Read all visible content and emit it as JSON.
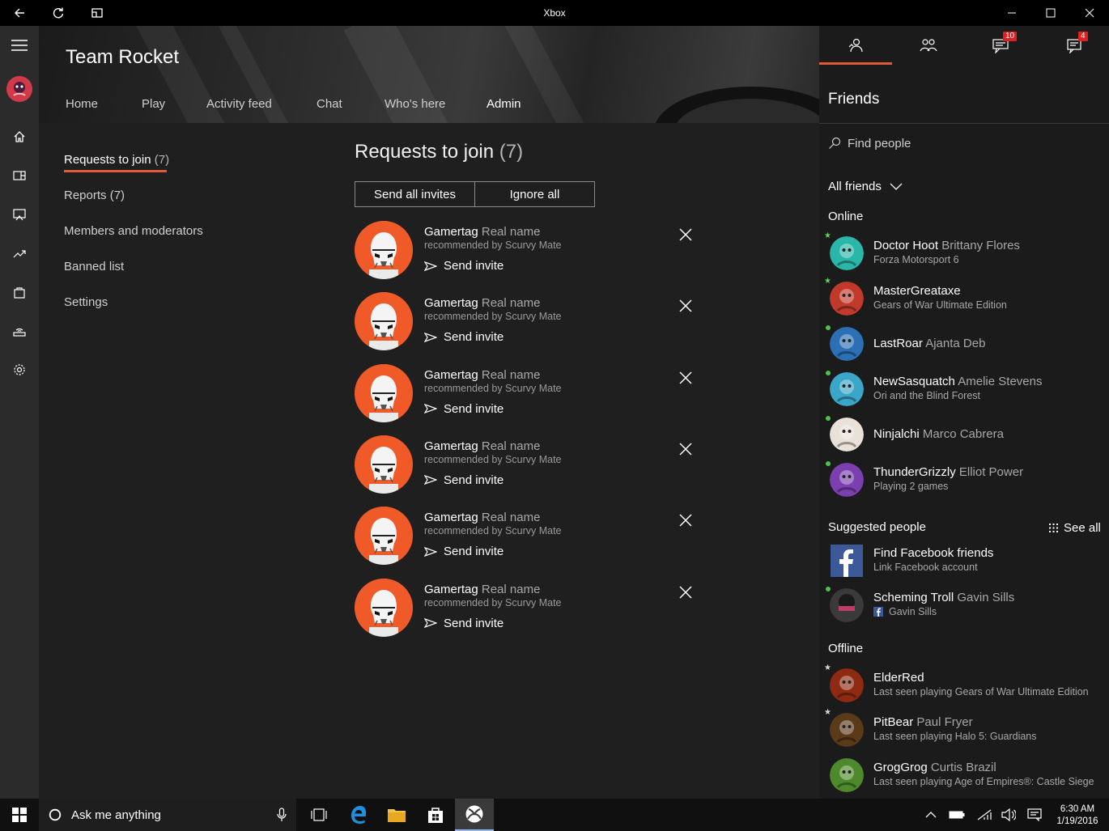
{
  "window": {
    "title": "Xbox"
  },
  "club": {
    "name": "Team Rocket"
  },
  "tabs": [
    "Home",
    "Play",
    "Activity feed",
    "Chat",
    "Who's here",
    "Admin"
  ],
  "admin_nav": {
    "items": [
      {
        "label": "Requests to join",
        "count": "(7)"
      },
      {
        "label": "Reports",
        "count": "(7)"
      },
      {
        "label": "Members and moderators",
        "count": ""
      },
      {
        "label": "Banned list",
        "count": ""
      },
      {
        "label": "Settings",
        "count": ""
      }
    ]
  },
  "requests": {
    "title": "Requests to join",
    "count": "(7)",
    "send_all": "Send all invites",
    "ignore_all": "Ignore all",
    "items": [
      {
        "gamertag": "Gamertag",
        "real_name": "Real name",
        "recommended": "recommended by Scurvy Mate",
        "action": "Send invite"
      },
      {
        "gamertag": "Gamertag",
        "real_name": "Real name",
        "recommended": "recommended by Scurvy Mate",
        "action": "Send invite"
      },
      {
        "gamertag": "Gamertag",
        "real_name": "Real name",
        "recommended": "recommended by Scurvy Mate",
        "action": "Send invite"
      },
      {
        "gamertag": "Gamertag",
        "real_name": "Real name",
        "recommended": "recommended by Scurvy Mate",
        "action": "Send invite"
      },
      {
        "gamertag": "Gamertag",
        "real_name": "Real name",
        "recommended": "recommended by Scurvy Mate",
        "action": "Send invite"
      },
      {
        "gamertag": "Gamertag",
        "real_name": "Real name",
        "recommended": "recommended by Scurvy Mate",
        "action": "Send invite"
      }
    ]
  },
  "friends_pane": {
    "title": "Friends",
    "badges": {
      "messages": "10",
      "notifications": "4"
    },
    "search_placeholder": "Find people",
    "filter": "All friends",
    "online_label": "Online",
    "online": [
      {
        "gamertag": "Doctor Hoot",
        "real_name": "Brittany Flores",
        "status": "Forza Motorsport 6",
        "favorite": true,
        "color": "#2ab7a9"
      },
      {
        "gamertag": "MasterGreataxe",
        "real_name": "",
        "status": "Gears of War Ultimate Edition",
        "favorite": true,
        "color": "#c0392b"
      },
      {
        "gamertag": "LastRoar",
        "real_name": "Ajanta Deb",
        "status": "",
        "favorite": false,
        "color": "#2c6fb5"
      },
      {
        "gamertag": "NewSasquatch",
        "real_name": "Amelie Stevens",
        "status": "Ori and the Blind Forest",
        "favorite": false,
        "color": "#3aa6c9"
      },
      {
        "gamertag": "Ninjalchi",
        "real_name": "Marco Cabrera",
        "status": "",
        "favorite": false,
        "color": "#e8e2d8"
      },
      {
        "gamertag": "ThunderGrizzly",
        "real_name": "Elliot Power",
        "status": "Playing 2 games",
        "favorite": false,
        "color": "#7b3fb0"
      }
    ],
    "suggested_label": "Suggested people",
    "see_all": "See all",
    "suggested": [
      {
        "gamertag": "Find Facebook friends",
        "real_name": "",
        "status": "Link Facebook account",
        "color": "#3b5998"
      },
      {
        "gamertag": "Scheming Troll",
        "real_name": "Gavin Sills",
        "status": "Gavin Sills",
        "color": "#444444"
      }
    ],
    "offline_label": "Offline",
    "offline": [
      {
        "gamertag": "ElderRed",
        "real_name": "",
        "status": "Last seen playing Gears of War Ultimate Edition",
        "favorite": true,
        "color": "#8e2a12"
      },
      {
        "gamertag": "PitBear",
        "real_name": "Paul Fryer",
        "status": "Last seen playing Halo 5: Guardians",
        "favorite": true,
        "color": "#5b3a1a"
      },
      {
        "gamertag": "GrogGrog",
        "real_name": "Curtis Brazil",
        "status": "Last seen playing Age of Empires®: Castle Siege",
        "favorite": false,
        "color": "#4e8a2c"
      }
    ]
  },
  "taskbar": {
    "search_text": "Ask me anything",
    "time": "6:30 AM",
    "date": "1/19/2016"
  },
  "colors": {
    "accent": "#e05a3a",
    "avatar_bg": "#f05a28",
    "online": "#4cc34c"
  }
}
